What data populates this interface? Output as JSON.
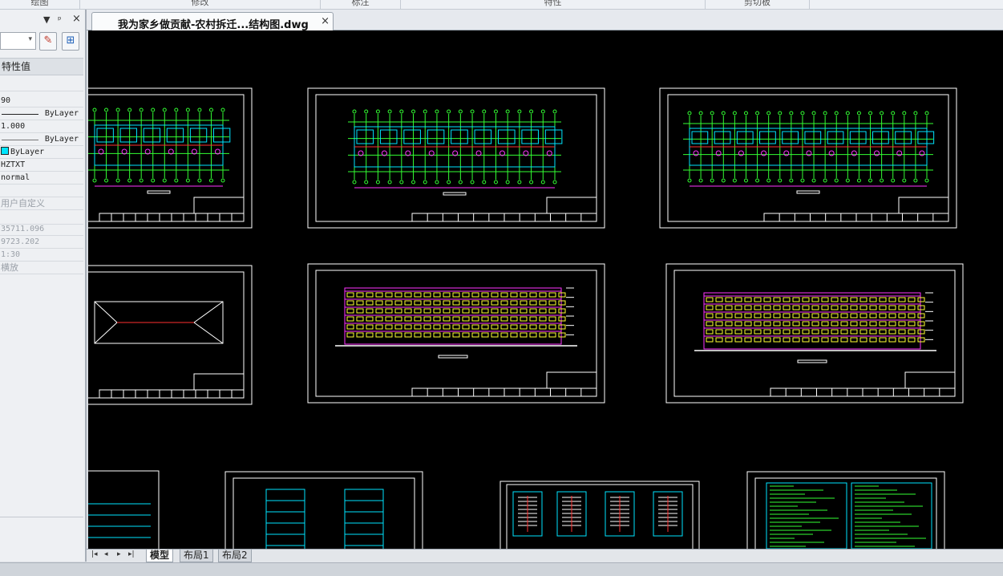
{
  "ribbon": {
    "groups": [
      "绘图",
      "修改",
      "标注",
      "特性",
      "剪切板"
    ]
  },
  "document_tab": {
    "title": "我为家乡做贡献-农村拆迁...结构图.dwg",
    "close_glyph": "×"
  },
  "palette": {
    "header_controls": {
      "menu": "▼",
      "pin": "ᵖ",
      "close": "×"
    },
    "select_arrow": "▾",
    "buttons": {
      "toggle_pickadd": "✎",
      "select_objects": "⊞"
    },
    "section_title": "特性值",
    "rows": [
      {
        "value": ""
      },
      {
        "value": "90"
      },
      {
        "value": "ByLayer",
        "linetype": "solid"
      },
      {
        "value": "1.000"
      },
      {
        "value": "ByLayer",
        "linetype": "thin"
      },
      {
        "value": "ByLayer",
        "color": "#00e5ff"
      },
      {
        "value": "HZTXT"
      },
      {
        "value": "normal"
      },
      {
        "value": ""
      },
      {
        "value": "用户自定义",
        "dim": true
      },
      {
        "value": ""
      },
      {
        "value": "35711.096",
        "dim": true
      },
      {
        "value": "9723.202",
        "dim": true
      },
      {
        "value": "1:30",
        "dim": true
      },
      {
        "value": "横放",
        "dim": true
      }
    ]
  },
  "layout_tabs": {
    "nav": [
      "|◂",
      "◂",
      "▸",
      "▸|"
    ],
    "tabs": [
      {
        "label": "模型",
        "active": true
      },
      {
        "label": "布局1",
        "active": false
      },
      {
        "label": "布局2",
        "active": false
      }
    ]
  },
  "colors": {
    "canvas_bg": "#000000",
    "sheet_border": "#ffffff",
    "axis_green": "#33ff33",
    "wall_cyan": "#00e5ff",
    "dim_magenta": "#ff33ff",
    "window_yellow": "#ffff33",
    "red": "#ff3030"
  }
}
